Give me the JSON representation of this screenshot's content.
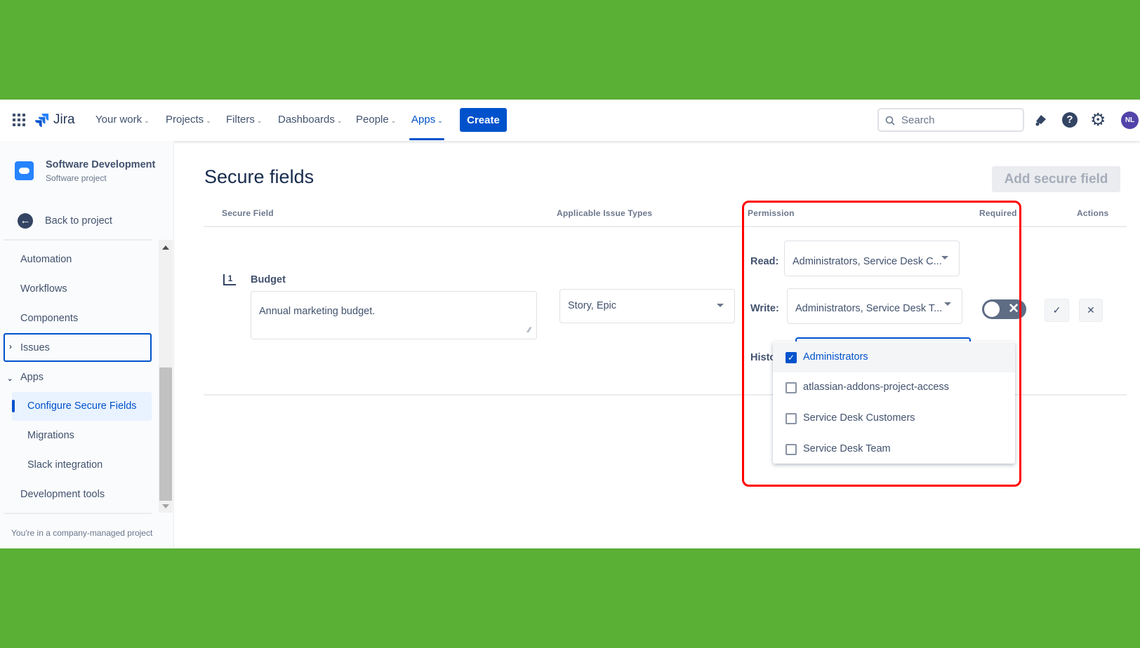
{
  "nav": {
    "app_name": "Jira",
    "items": [
      {
        "label": "Your work"
      },
      {
        "label": "Projects"
      },
      {
        "label": "Filters"
      },
      {
        "label": "Dashboards"
      },
      {
        "label": "People"
      },
      {
        "label": "Apps"
      }
    ],
    "active": "Apps",
    "create_label": "Create",
    "search_placeholder": "Search",
    "avatar_initials": "NL"
  },
  "sidebar": {
    "project_name": "Software Development",
    "project_type": "Software project",
    "back_label": "Back to project",
    "items": [
      {
        "label": "Automation"
      },
      {
        "label": "Workflows"
      },
      {
        "label": "Components"
      },
      {
        "label": "Issues"
      },
      {
        "label": "Apps"
      },
      {
        "label": "Configure Secure Fields"
      },
      {
        "label": "Migrations"
      },
      {
        "label": "Slack integration"
      },
      {
        "label": "Development tools"
      }
    ],
    "footer": "You're in a company-managed project"
  },
  "main": {
    "title": "Secure fields",
    "add_button": "Add secure field",
    "columns": [
      "Secure Field",
      "Applicable Issue Types",
      "Permission",
      "Required",
      "Actions"
    ],
    "row": {
      "name": "Budget",
      "description": "Annual marketing budget.",
      "issue_types": "Story, Epic",
      "read_label": "Read:",
      "read_value": "Administrators, Service Desk C...",
      "write_label": "Write:",
      "write_value": "Administrators, Service Desk T...",
      "history_label": "Histo",
      "required": false
    },
    "dropdown": {
      "options": [
        {
          "label": "Administrators",
          "checked": true
        },
        {
          "label": "atlassian-addons-project-access",
          "checked": false
        },
        {
          "label": "Service Desk Customers",
          "checked": false
        },
        {
          "label": "Service Desk Team",
          "checked": false
        }
      ]
    }
  },
  "colors": {
    "brand": "#0052cc",
    "highlight": "#ff0000",
    "background": "#5aaf35"
  }
}
